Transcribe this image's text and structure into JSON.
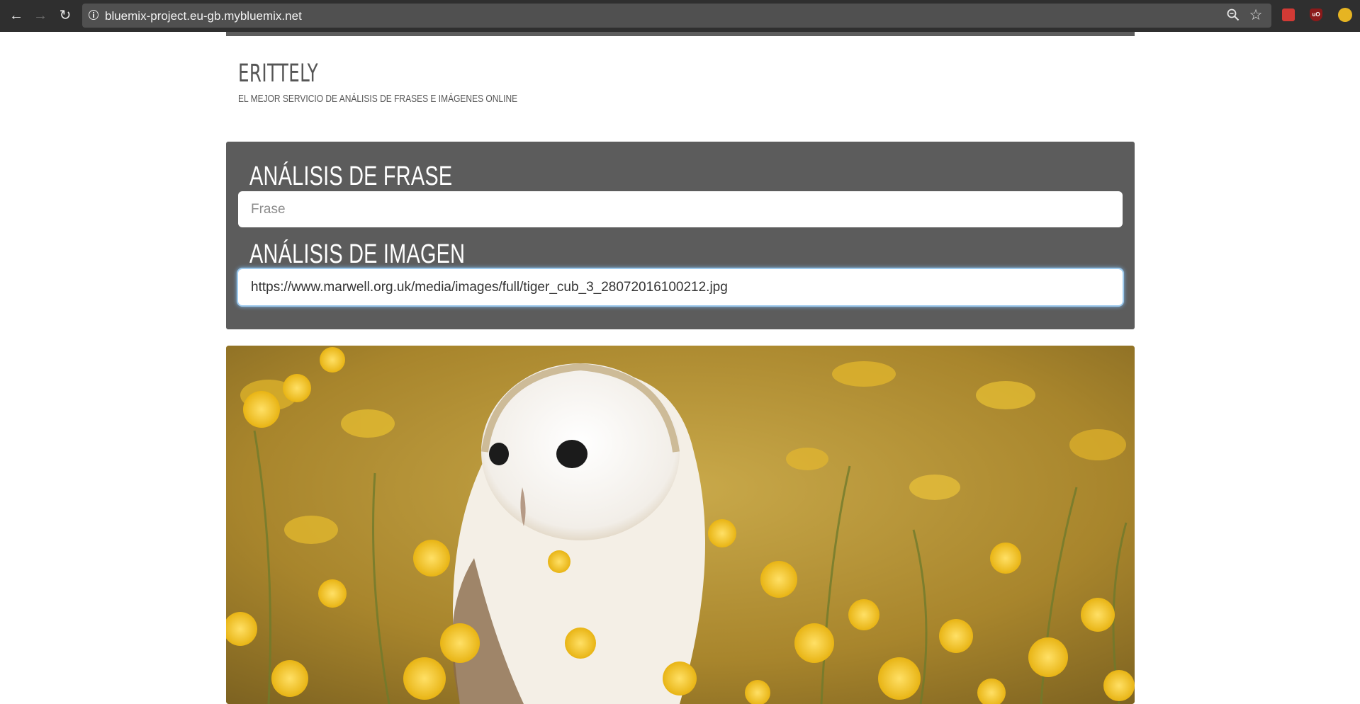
{
  "browser": {
    "url": "bluemix-project.eu-gb.mybluemix.net",
    "icons": {
      "back": "back-arrow-icon",
      "forward": "forward-arrow-icon",
      "reload": "reload-icon",
      "info": "info-icon",
      "zoom": "zoom-icon",
      "bookmark": "star-icon"
    },
    "extensions": [
      "red-book-extension-icon",
      "ublock-extension-icon",
      "yellow-circle-extension-icon"
    ]
  },
  "site": {
    "title": "ERITTELY",
    "tagline": "EL MEJOR SERVICIO DE ANÁLISIS DE FRASES E IMÁGENES ONLINE"
  },
  "phrase_section": {
    "heading": "ANÁLISIS DE FRASE",
    "placeholder": "Frase",
    "value": ""
  },
  "image_section": {
    "heading": "ANÁLISIS DE IMAGEN",
    "value": "https://www.marwell.org.uk/media/images/full/tiger_cub_3_28072016100212.jpg"
  },
  "colors": {
    "panel": "#5c5c5c",
    "chrome": "#2f2f2f",
    "omnibox": "#505050",
    "heading": "#ffffff",
    "title": "#555555",
    "focus_ring": "#7bb4e6"
  }
}
